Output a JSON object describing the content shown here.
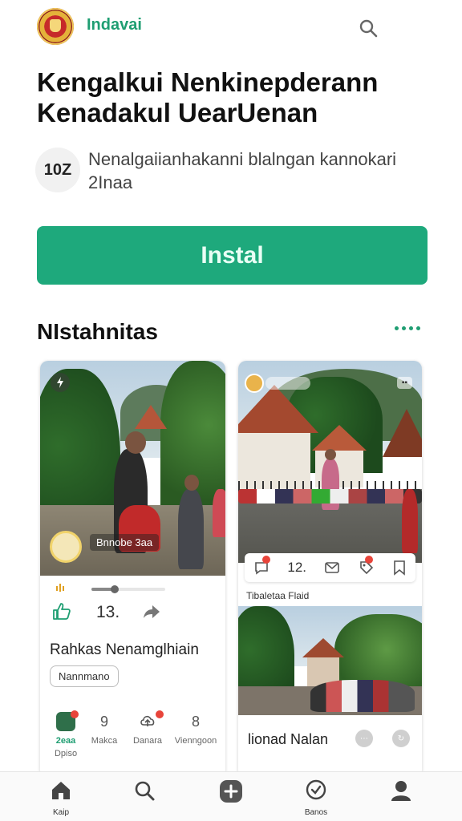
{
  "header": {
    "app_name": "Indavai"
  },
  "title": "Kengalkui Nenkinepderann Kenadakul UearUenan",
  "rating_badge": "10Z",
  "subtitle": "Nenalgaiianhakanni blalngan kannokari 2Inaa",
  "install_label": "Instal",
  "section": {
    "title": "NIstahnitas"
  },
  "card_left": {
    "overlay_label": "Bnnobe 3aa",
    "like_count": "13.",
    "name": "Rahkas Nenamglhiain",
    "chip": "Nannmano",
    "progress": 0.32,
    "stats": [
      {
        "value": "",
        "label": "2eaa"
      },
      {
        "value": "9",
        "label": "Makca"
      },
      {
        "value": "",
        "label": "Danara"
      },
      {
        "value": "8",
        "label": "Vienngoon"
      }
    ],
    "stat_sub_label": "Dpiso"
  },
  "card_right": {
    "action_count": "12.",
    "caption": "Tibaletaa Flaid",
    "title": "lionad Nalan"
  },
  "bottom_nav": [
    {
      "label": "Kaip",
      "icon": "home-icon"
    },
    {
      "label": "",
      "icon": "search-icon"
    },
    {
      "label": "",
      "icon": "add-icon"
    },
    {
      "label": "Banos",
      "icon": "check-circle-icon"
    },
    {
      "label": "",
      "icon": "profile-icon"
    }
  ],
  "colors": {
    "accent": "#1ea97c",
    "accent_text": "#1f9e72",
    "notification": "#e8443a"
  }
}
